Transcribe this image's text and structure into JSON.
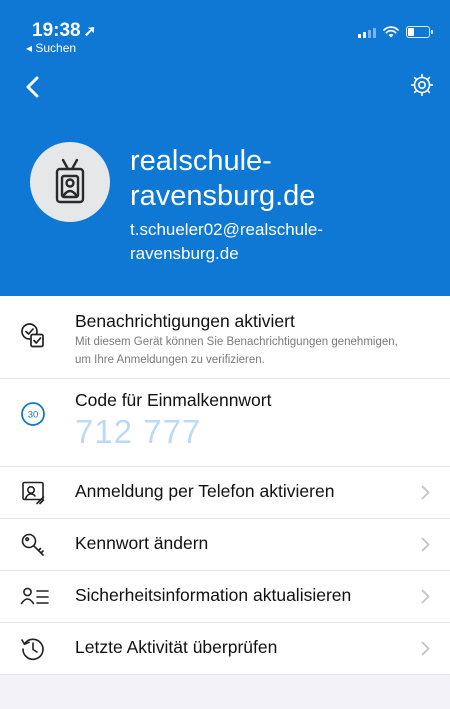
{
  "status_bar": {
    "time": "19:38",
    "back_app": "Suchen"
  },
  "account": {
    "name": "realschule-ravensburg.de",
    "email": "t.schueler02@realschule-ravensburg.de"
  },
  "notifications": {
    "title": "Benachrichtigungen aktiviert",
    "description": "Mit diesem Gerät können Sie Benachrichtigungen genehmigen, um Ihre Anmeldungen zu verifizieren."
  },
  "otp": {
    "title": "Code für Einmalkennwort",
    "code": "712 777",
    "countdown": "30"
  },
  "actions": [
    {
      "label": "Anmeldung per Telefon aktivieren",
      "icon": "phone-signin-icon"
    },
    {
      "label": "Kennwort ändern",
      "icon": "key-icon"
    },
    {
      "label": "Sicherheitsinformation aktualisieren",
      "icon": "security-info-icon"
    },
    {
      "label": "Letzte Aktivität überprüfen",
      "icon": "history-icon"
    }
  ],
  "colors": {
    "header": "#0f78d4",
    "accent": "#0f78d4",
    "otp_code": "#bcdaf6"
  }
}
